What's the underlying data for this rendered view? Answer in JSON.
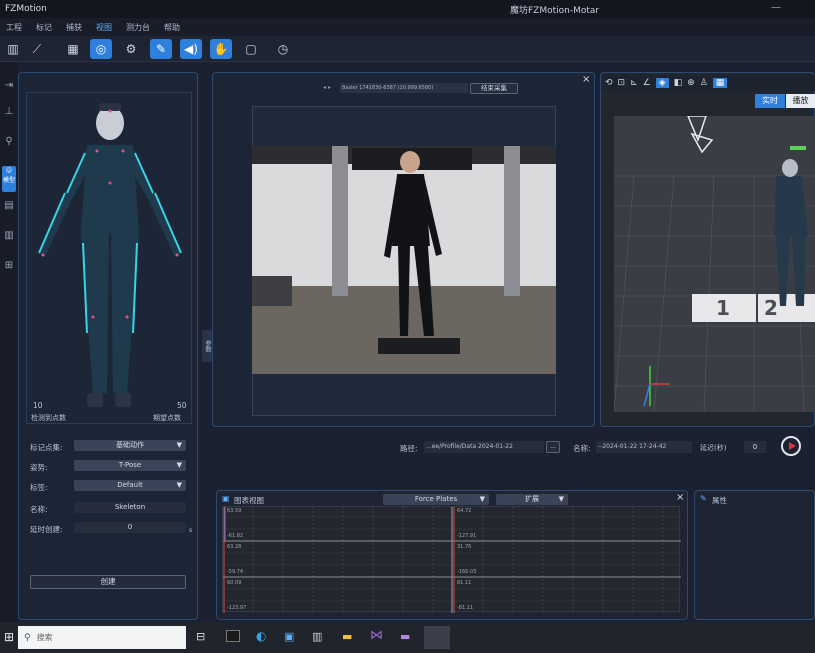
{
  "titlebar": {
    "app_name": "FZMotion",
    "window_title": "魔坊FZMotion-Motar"
  },
  "menu": {
    "items": [
      "工程",
      "标记",
      "捕获",
      "视图",
      "测力台",
      "帮助"
    ],
    "active_index": 3
  },
  "toolbar": {
    "icons": [
      "stats-icon",
      "line-chart-icon",
      "grid-icon",
      "camera-icon",
      "gear-icon",
      "wrench-icon",
      "speaker-icon",
      "hand-icon",
      "box-icon",
      "clock-icon"
    ],
    "active": [
      3,
      5,
      6,
      7
    ]
  },
  "sidebar": {
    "active_label": "模型"
  },
  "left_panel": {
    "markers_left_value": "10",
    "markers_left_label": "检测到点数",
    "markers_right_value": "50",
    "markers_right_label": "期望点数",
    "marker_set_label": "标记点集:",
    "marker_set_value": "基础动作",
    "pose_label": "姿势:",
    "pose_value": "T-Pose",
    "tag_label": "标签:",
    "tag_value": "Default",
    "name_label": "名称:",
    "name_value": "Skeleton",
    "delay_label": "延时创建:",
    "delay_value": "0",
    "delay_unit": "s",
    "create_button": "创建"
  },
  "video_panel": {
    "camera_label": "Basler 1741830-6387 (10.999.6580)",
    "stop_button": "结束采集",
    "side_tab": "参数"
  },
  "viewport": {
    "tab_realtime": "实时",
    "tab_playback": "播放",
    "floor_numbers": [
      "1",
      "2"
    ]
  },
  "record_bar": {
    "path_label": "路径:",
    "path_value": "...ee/Profile/Data 2024-01-22",
    "browse": "...",
    "name_label": "名称:",
    "name_value": "--2024-01-22 17-24-42",
    "delay_label": "延迟(秒)",
    "delay_value": "0"
  },
  "graph_panel": {
    "title": "图表视图",
    "source_select": "Force Plates",
    "type_select": "扩展",
    "left_col_labels": [
      "63.59",
      "-61.82",
      "63.28",
      "-59.74",
      "60.09",
      "-123.97"
    ],
    "right_col_labels": [
      "64.72",
      "-127.91",
      "31.76",
      "-166.03",
      "81.11",
      "-81.11"
    ]
  },
  "properties_panel": {
    "title": "属性"
  },
  "taskbar": {
    "search_placeholder": "搜索"
  }
}
